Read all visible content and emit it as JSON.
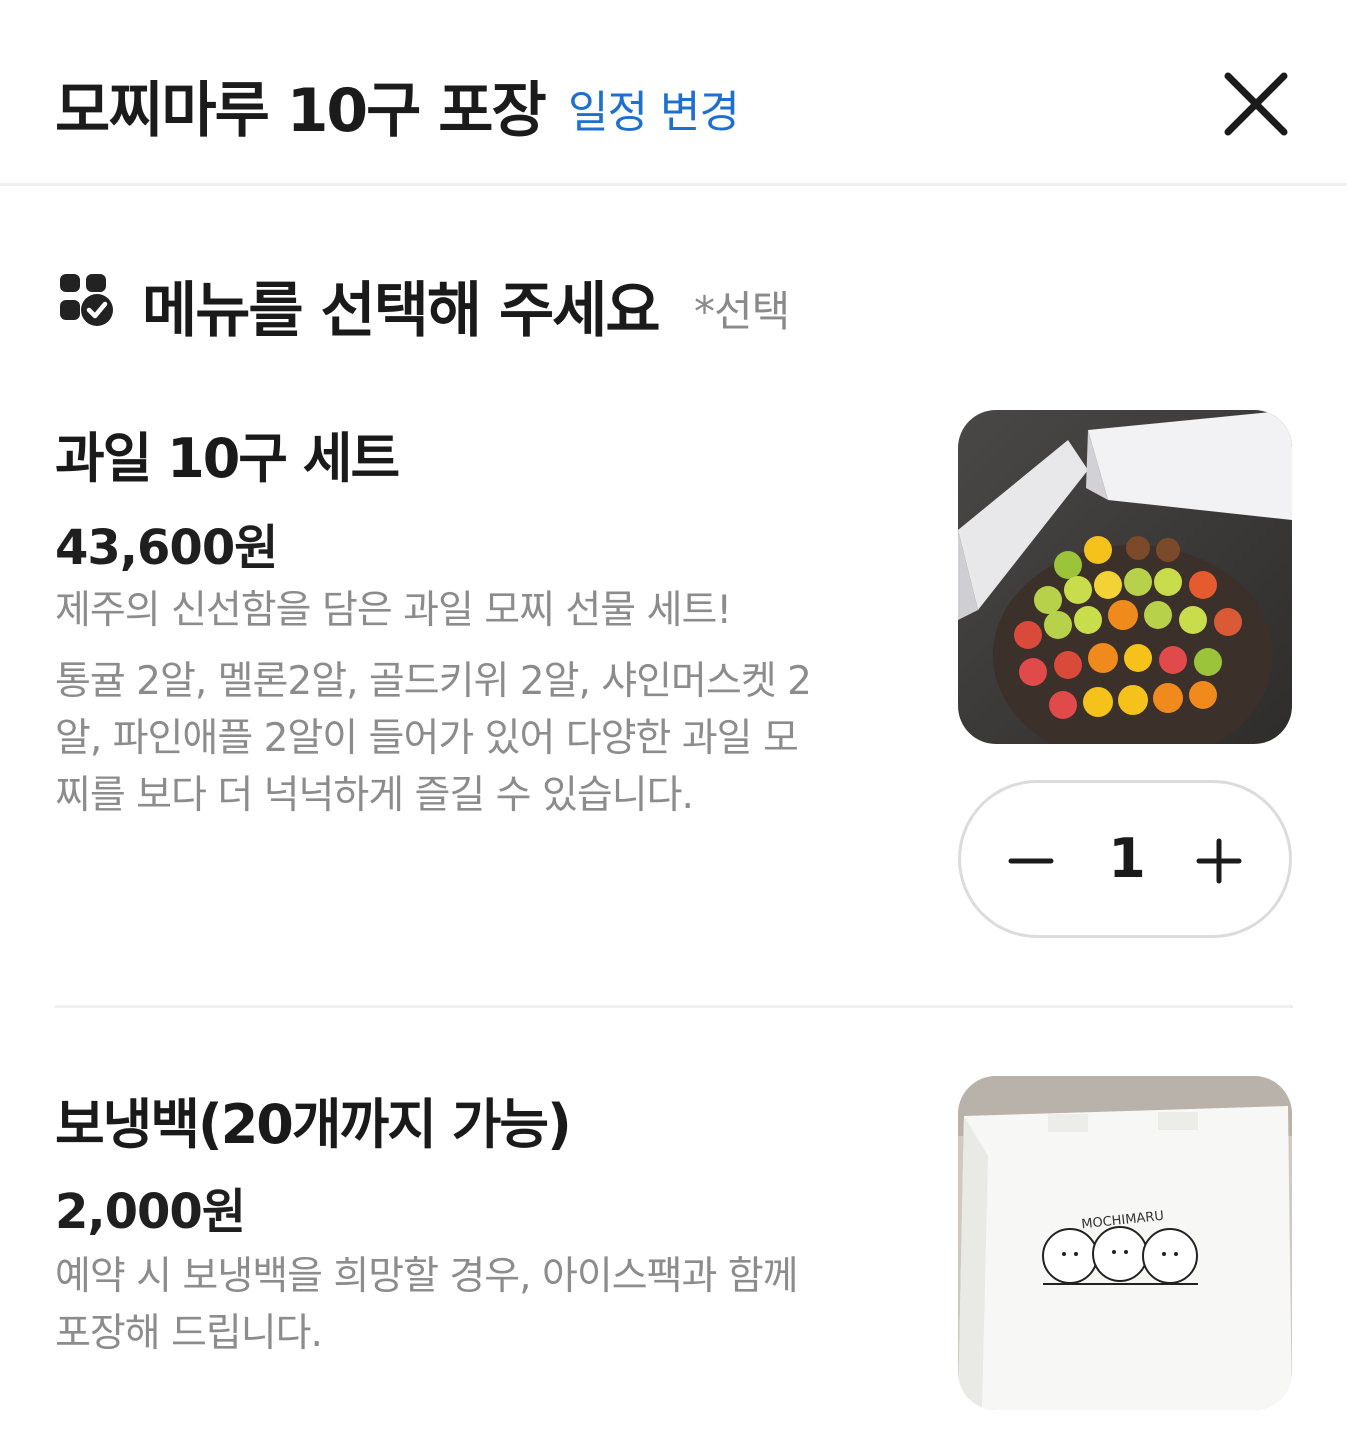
{
  "header": {
    "title": "모찌마루 10구 포장",
    "change_schedule_link": "일정 변경",
    "close_icon": "close-icon"
  },
  "section": {
    "icon": "menu-check-icon",
    "title": "메뉴를 선택해 주세요",
    "note": "*선택"
  },
  "items": [
    {
      "name": "과일 10구 세트",
      "price": "43,600원",
      "desc_lines": [
        "제주의 신선함을 담은 과일 모찌 선물 세트!",
        "통귤 2알, 멜론2알, 골드키위 2알, 샤인머스켓 2",
        "알, 파인애플 2알이 들어가 있어 다양한 과일 모",
        "찌를 보다 더 넉넉하게 즐길 수 있습니다."
      ],
      "image": "fruit-mochi-set-photo",
      "quantity": "1"
    },
    {
      "name": "보냉백(20개까지 가능)",
      "price": "2,000원",
      "desc_lines": [
        "예약 시 보냉백을 희망할 경우, 아이스팩과 함께",
        "포장해 드립니다."
      ],
      "image": "cooler-bag-photo",
      "bag_logo_text": "MOCHIMARU"
    }
  ],
  "colors": {
    "accent_link": "#1f6fd1",
    "text_primary": "#1b1b1b",
    "text_secondary": "#8c8c8c",
    "divider": "#efefef"
  }
}
